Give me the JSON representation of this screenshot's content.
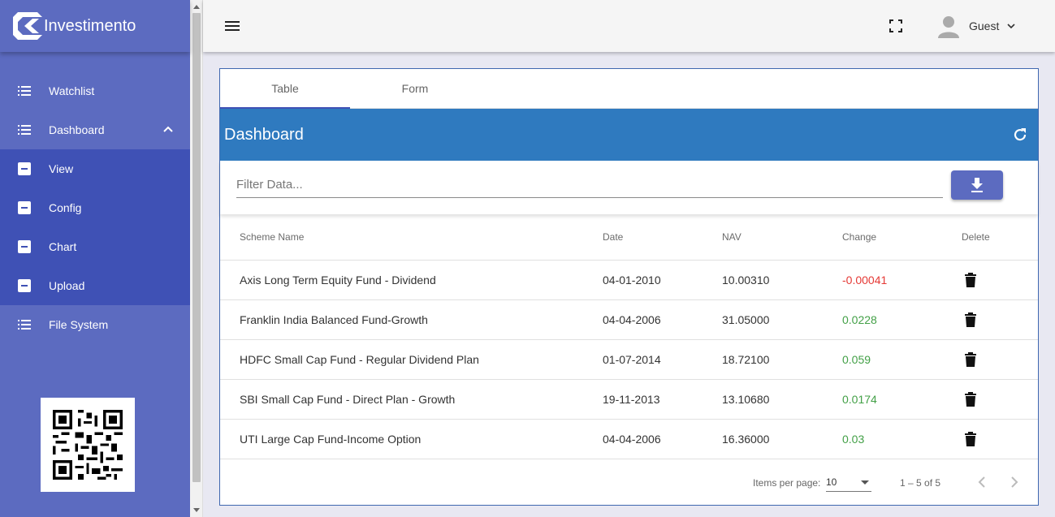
{
  "brand": {
    "name": "Investimento"
  },
  "sidebar": {
    "items": [
      {
        "label": "Watchlist"
      },
      {
        "label": "Dashboard"
      }
    ],
    "subitems": [
      {
        "label": "View"
      },
      {
        "label": "Config"
      },
      {
        "label": "Chart"
      },
      {
        "label": "Upload"
      }
    ],
    "bottom_item": {
      "label": "File System"
    }
  },
  "topbar": {
    "user_name": "Guest"
  },
  "tabs": [
    {
      "label": "Table"
    },
    {
      "label": "Form"
    }
  ],
  "dashboard": {
    "title": "Dashboard",
    "filter_placeholder": "Filter Data...",
    "columns": {
      "name": "Scheme Name",
      "date": "Date",
      "nav": "NAV",
      "change": "Change",
      "delete": "Delete"
    },
    "rows": [
      {
        "name": "Axis Long Term Equity Fund - Dividend",
        "date": "04-01-2010",
        "nav": "10.00310",
        "change": "-0.00041"
      },
      {
        "name": "Franklin India Balanced Fund-Growth",
        "date": "04-04-2006",
        "nav": "31.05000",
        "change": "0.0228"
      },
      {
        "name": "HDFC Small Cap Fund - Regular Dividend Plan",
        "date": "01-07-2014",
        "nav": "18.72100",
        "change": "0.059"
      },
      {
        "name": "SBI Small Cap Fund - Direct Plan - Growth",
        "date": "19-11-2013",
        "nav": "13.10680",
        "change": "0.0174"
      },
      {
        "name": "UTI Large Cap Fund-Income Option",
        "date": "04-04-2006",
        "nav": "16.36000",
        "change": "0.03"
      }
    ]
  },
  "pager": {
    "items_label": "Items per page:",
    "page_size": "10",
    "range": "1 – 5 of 5"
  },
  "colors": {
    "sidebar": "#5c6bc0",
    "sidebar_sub": "#3f51b5",
    "band": "#2f7abf",
    "negative": "#e53935",
    "positive": "#43a047"
  }
}
